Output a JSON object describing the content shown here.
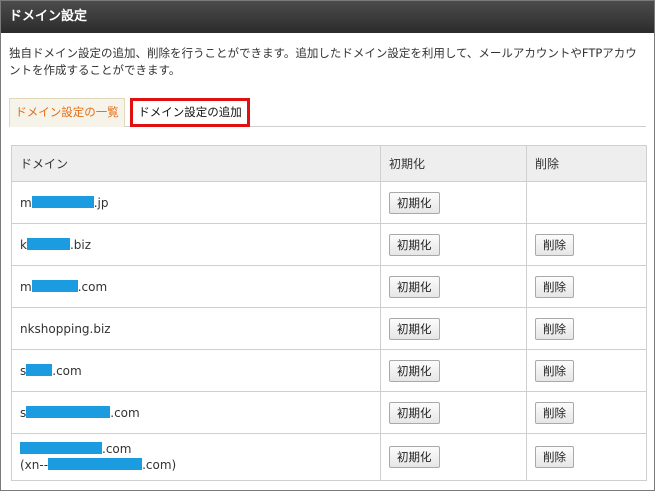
{
  "panel": {
    "title": "ドメイン設定"
  },
  "description": "独自ドメイン設定の追加、削除を行うことができます。追加したドメイン設定を利用して、メールアカウントやFTPアカウントを作成することができます。",
  "tabs": [
    {
      "label": "ドメイン設定の一覧",
      "active": true
    },
    {
      "label": "ドメイン設定の追加",
      "active": false,
      "highlighted": true
    }
  ],
  "table": {
    "headers": {
      "domain": "ドメイン",
      "init": "初期化",
      "delete": "削除"
    },
    "init_button_label": "初期化",
    "delete_button_label": "削除",
    "rows": [
      {
        "prefix": "m",
        "suffix": ".jp",
        "has_delete": false
      },
      {
        "prefix": "k",
        "suffix": ".biz",
        "has_delete": true
      },
      {
        "prefix": "m",
        "suffix": ".com",
        "has_delete": true
      },
      {
        "prefix": "nkshopping.biz",
        "suffix": "",
        "has_delete": true
      },
      {
        "prefix": "s",
        "suffix": ".com",
        "has_delete": true
      },
      {
        "prefix": "s",
        "suffix": ".com",
        "has_delete": true
      },
      {
        "prefix": "",
        "suffix": ".com",
        "second_line_prefix": "(xn--",
        "second_line_suffix": ".com)",
        "has_delete": true
      }
    ]
  },
  "colors": {
    "title_bar": "#333333",
    "active_tab_text": "#e46d16",
    "highlight_border": "#e01010",
    "redaction": "#1c9ce0"
  }
}
